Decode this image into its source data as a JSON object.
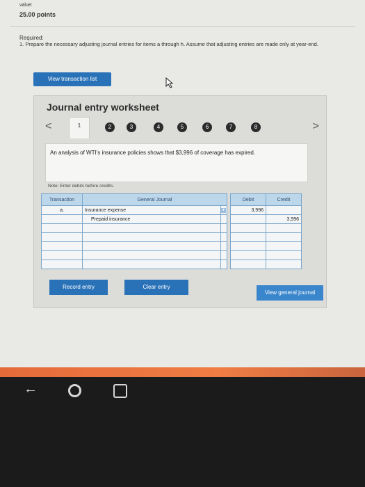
{
  "header": {
    "value_label": "value:",
    "points": "25.00 points",
    "required": "Required:",
    "instructions": "1. Prepare the necessary adjusting journal entries for items a through h. Assume that adjusting entries are made only at year-end."
  },
  "view_list_label": "View transaction list",
  "worksheet": {
    "title": "Journal entry worksheet",
    "prev": "<",
    "next": ">",
    "active_tab": "1",
    "steps": [
      "2",
      "3",
      "4",
      "5",
      "6",
      "7",
      "8"
    ],
    "description": "An analysis of WTI's insurance policies shows that $3,996 of coverage has expired.",
    "note": "Note: Enter debits before credits."
  },
  "journal": {
    "headers": {
      "transaction": "Transaction",
      "general_journal": "General Journal",
      "debit": "Debit",
      "credit": "Credit"
    },
    "rows": [
      {
        "transaction": "a.",
        "account": "Insurance expense",
        "debit": "3,996",
        "credit": ""
      },
      {
        "transaction": "",
        "account": "Prepaid insurance",
        "debit": "",
        "credit": "3,996"
      },
      {
        "transaction": "",
        "account": "",
        "debit": "",
        "credit": ""
      },
      {
        "transaction": "",
        "account": "",
        "debit": "",
        "credit": ""
      },
      {
        "transaction": "",
        "account": "",
        "debit": "",
        "credit": ""
      },
      {
        "transaction": "",
        "account": "",
        "debit": "",
        "credit": ""
      },
      {
        "transaction": "",
        "account": "",
        "debit": "",
        "credit": ""
      }
    ]
  },
  "buttons": {
    "record": "Record entry",
    "clear": "Clear entry",
    "view_journal": "View general journal"
  },
  "colors": {
    "accent": "#2a72b8",
    "taskbar": "#f07d44"
  }
}
